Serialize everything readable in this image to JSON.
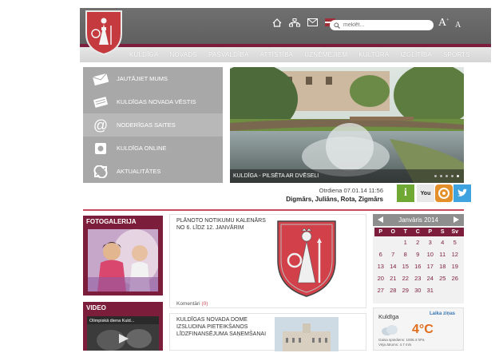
{
  "header": {
    "search_placeholder": "meklēt...",
    "font_large": "A",
    "font_small": "A",
    "font_large_sup": "+"
  },
  "nav": [
    "KULDĪGA",
    "NOVADS",
    "PAŠVALDĪBA",
    "ATTĪSTĪBA",
    "UZŅĒMĒJIEM",
    "KULTŪRA",
    "IZGLĪTĪBA",
    "SPORTS"
  ],
  "menu": [
    {
      "label": "JAUTĀJIET MUMS",
      "icon": "mail-icon"
    },
    {
      "label": "KULDĪGAS NOVADA VĒSTIS",
      "icon": "newspaper-icon"
    },
    {
      "label": "NODERĪGAS SAITES",
      "icon": "at-icon"
    },
    {
      "label": "KULDĪGA ONLINE",
      "icon": "camera-icon"
    },
    {
      "label": "AKTUALITĀTES",
      "icon": "arrows-icon"
    }
  ],
  "hero": {
    "caption": "KULDĪGA - PILSĒTA AR DVĒSELI"
  },
  "date_line": "Otrdiena  07.01.14 11:56",
  "names_line": "Digmārs, Juliāns, Rota, Zigmārs",
  "social": [
    {
      "name": "info",
      "label": "i",
      "color": "#6fa832"
    },
    {
      "name": "youtube",
      "label": "You",
      "color": "#e8e8e8"
    },
    {
      "name": "rss",
      "label": "",
      "color": "#e4902a"
    },
    {
      "name": "twitter",
      "label": "",
      "color": "#3fa3e0"
    }
  ],
  "foto": {
    "title": "FOTOGALERIJA"
  },
  "video": {
    "title": "VIDEO",
    "caption": "Olimpiskā diena Kuld..."
  },
  "news": [
    {
      "title": "PLĀNOTO NOTIKUMU KALENĀRS NO 6. LĪDZ 12. JANVĀRIM",
      "comments": "Komentāri",
      "count": "(0)"
    },
    {
      "title": "KULDĪGAS NOVADA DOME IZSLUDINA PIETEIKŠANOS LĪDZFINANSĒJUMA SAŅEMŠANAI"
    }
  ],
  "calendar": {
    "month": "Janvāris 2014",
    "days": [
      "P",
      "O",
      "T",
      "C",
      "P",
      "S",
      "Sv"
    ],
    "rows": [
      [
        "",
        "",
        "1",
        "2",
        "3",
        "4",
        "5"
      ],
      [
        "6",
        "7",
        "8",
        "9",
        "10",
        "11",
        "12"
      ],
      [
        "13",
        "14",
        "15",
        "16",
        "17",
        "18",
        "19"
      ],
      [
        "20",
        "21",
        "22",
        "23",
        "24",
        "25",
        "26"
      ],
      [
        "27",
        "28",
        "29",
        "30",
        "31",
        "",
        ""
      ]
    ]
  },
  "weather": {
    "city": "Kuldīga",
    "brand": "Laika ziņas",
    "temp": "4°C",
    "info1": "Gaisa spiediens: 1006.4 hPa",
    "info2": "Vēja ātrums: 4.7 m/s"
  },
  "colors": {
    "accent": "#7c1d3c",
    "header_grey": "#666666",
    "nav_grey": "#dcdcdc",
    "menu_grey": "#a8a8a8"
  }
}
